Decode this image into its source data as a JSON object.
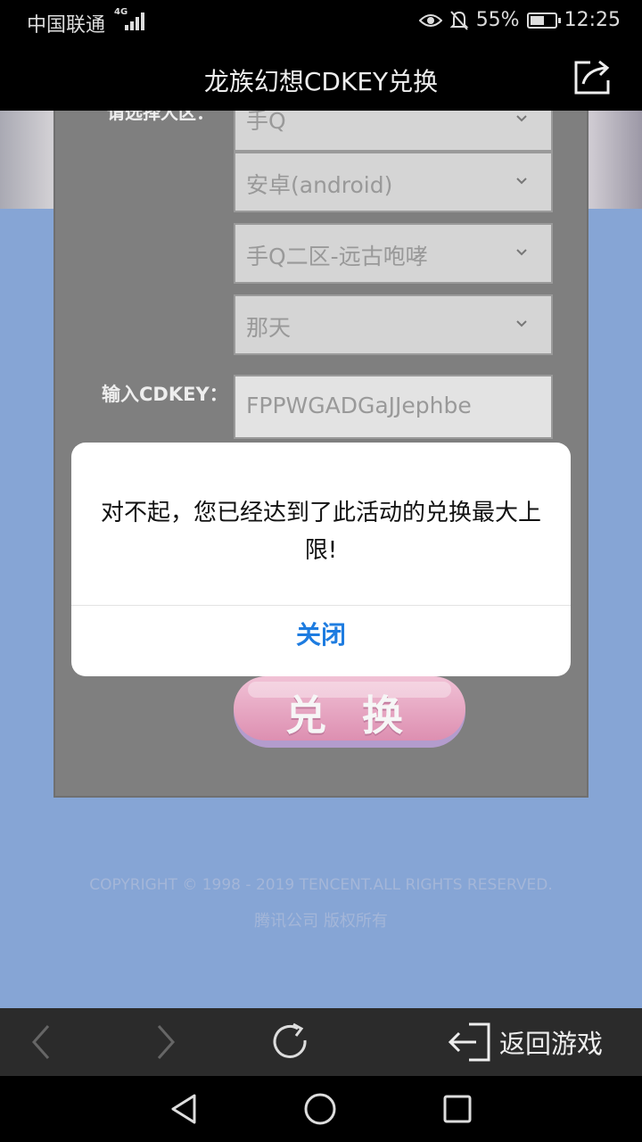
{
  "status_bar": {
    "carrier": "中国联通",
    "network": "4G",
    "battery": "55%",
    "time": "12:25",
    "icons": [
      "eye-comfort-icon",
      "bell-muted-icon",
      "battery-icon"
    ]
  },
  "title_bar": {
    "title": "龙族幻想CDKEY兑换",
    "share_icon": "share-icon"
  },
  "form": {
    "select_label": "请选择大区：",
    "selects": [
      {
        "value": "手Q"
      },
      {
        "value": "安卓(android)"
      },
      {
        "value": "手Q二区-远古咆哮"
      },
      {
        "value": "那天"
      }
    ],
    "cdkey_label": "输入CDKEY：",
    "cdkey_value": "FPPWGADGaJJephbe",
    "exchange_button": "兑 换"
  },
  "footer": {
    "copyright": "COPYRIGHT © 1998 - 2019 TENCENT.ALL RIGHTS RESERVED.",
    "rights": "腾讯公司 版权所有"
  },
  "modal": {
    "message": "对不起，您已经达到了此活动的兑换最大上限!",
    "close_label": "关闭"
  },
  "toolbar": {
    "back_to_game": "返回游戏",
    "icons": [
      "back-arrow-icon",
      "forward-arrow-icon",
      "refresh-icon",
      "exit-icon"
    ]
  },
  "colors": {
    "page_bg": "#86a5d5",
    "panel_bg": "#7f7f7f",
    "modal_button": "#1e7ce0",
    "exchange_button": "#e09ebf"
  }
}
